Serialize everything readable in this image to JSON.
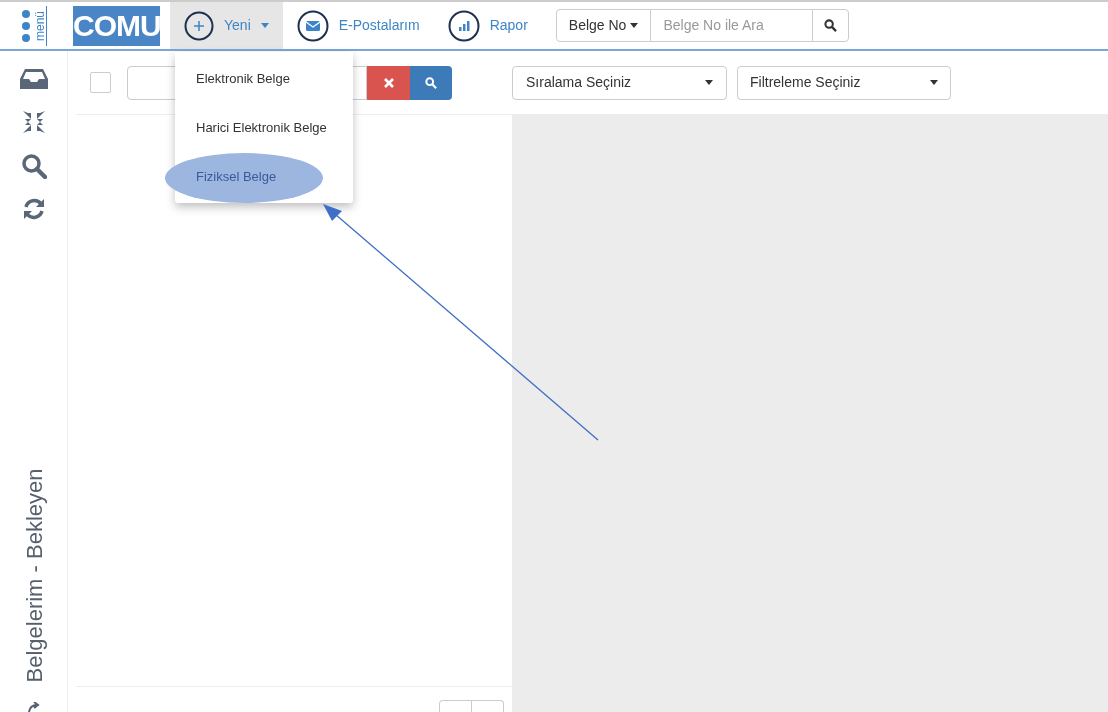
{
  "topbar": {
    "menu_label": "menü",
    "logo": "COMU",
    "nav": [
      {
        "kind": "new",
        "label": "Yeni",
        "expanded": true
      },
      {
        "kind": "mail",
        "label": "E-Postalarım",
        "expanded": false
      },
      {
        "kind": "report",
        "label": "Rapor",
        "expanded": false
      }
    ],
    "search": {
      "type_label": "Belge No",
      "placeholder": "Belge No ile Ara"
    }
  },
  "new_menu": [
    {
      "label": "Elektronik Belge",
      "highlighted": false
    },
    {
      "label": "Harici Elektronik Belge",
      "highlighted": false
    },
    {
      "label": "Fiziksel Belge",
      "highlighted": true
    }
  ],
  "sidebar": {
    "title": "Belgelerim - Bekleyen"
  },
  "list_toolbar": {
    "checked": false
  },
  "sort_select": "Sıralama Seçiniz",
  "filter_select": "Filtreleme Seçiniz"
}
